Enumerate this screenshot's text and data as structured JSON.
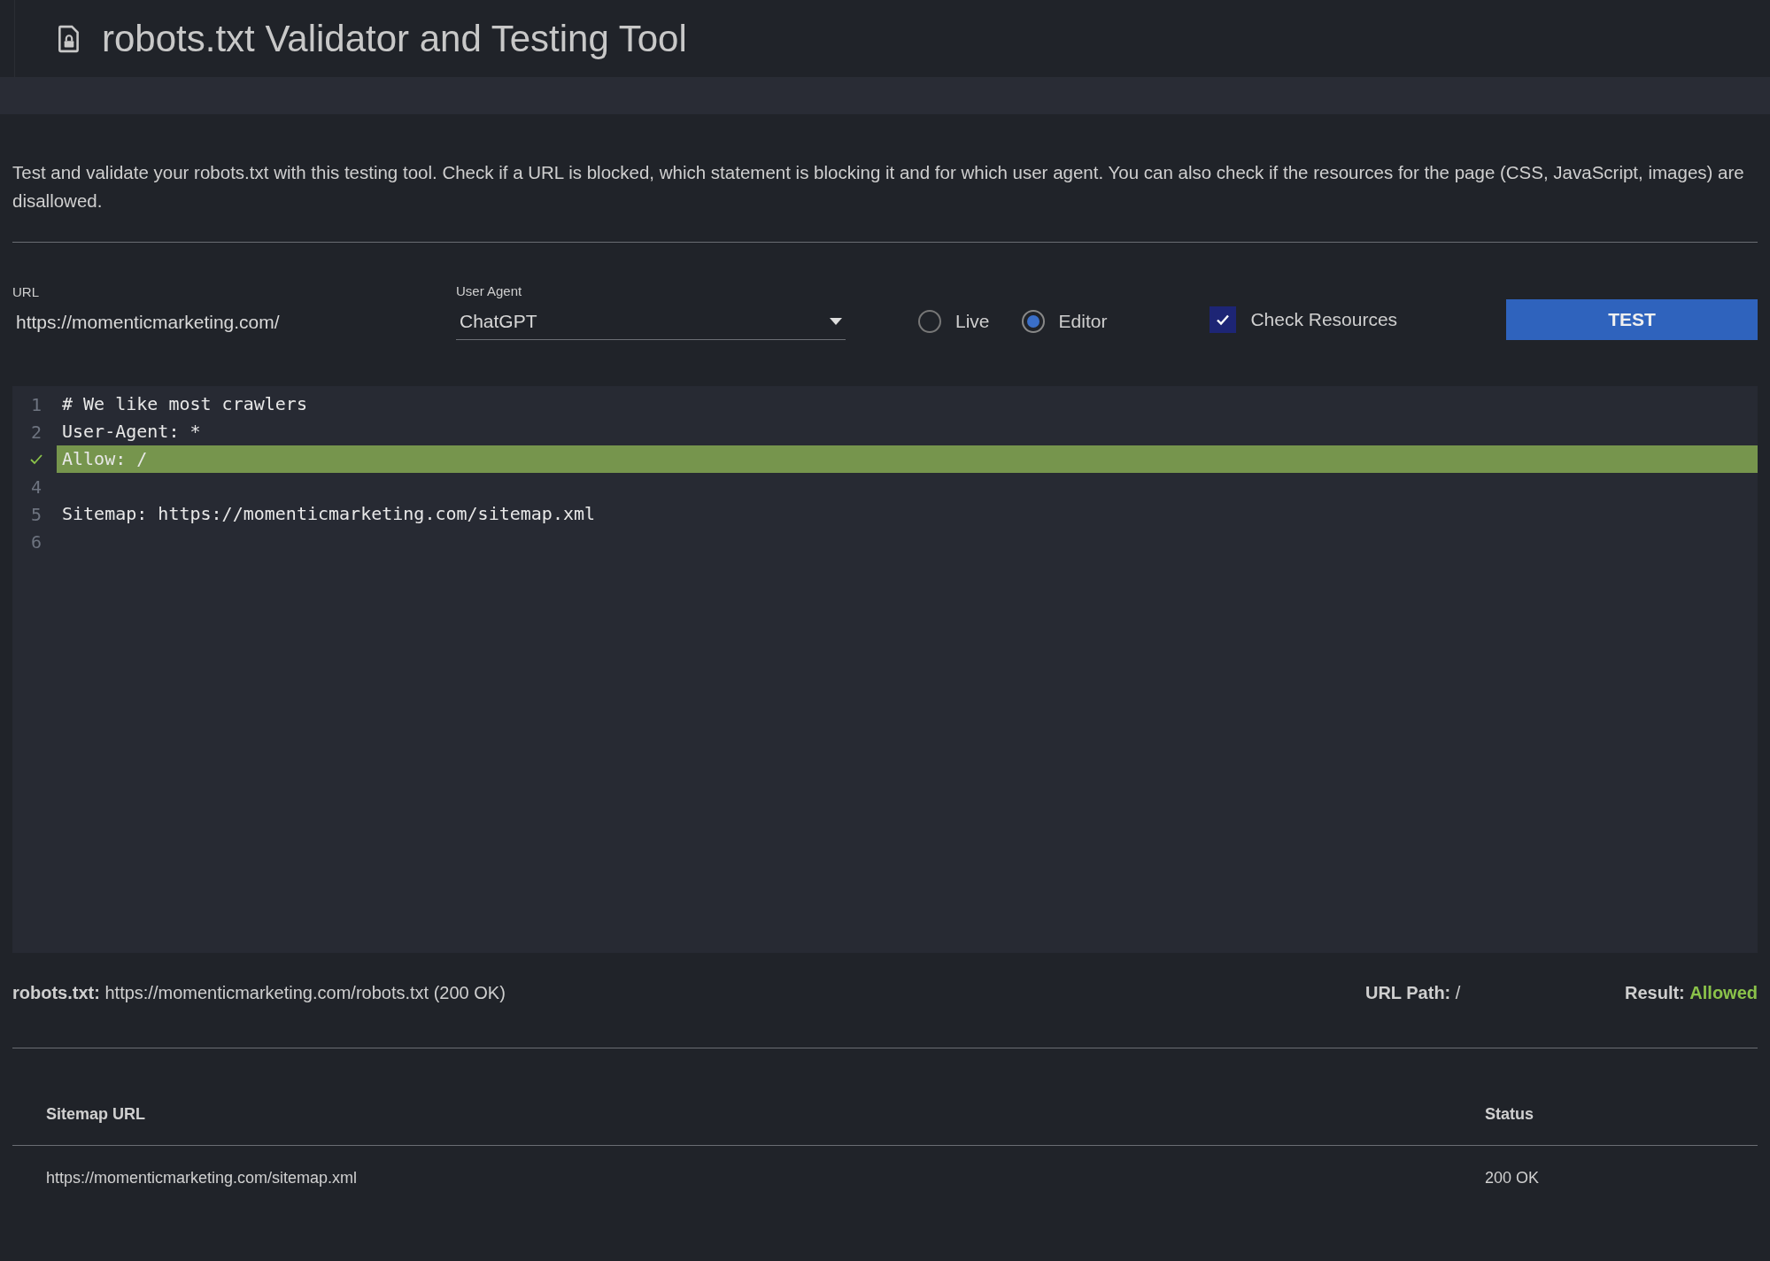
{
  "header": {
    "title": "robots.txt Validator and Testing Tool"
  },
  "description": "Test and validate your robots.txt with this testing tool. Check if a URL is blocked, which statement is blocking it and for which user agent. You can also check if the resources for the page (CSS, JavaScript, images) are disallowed.",
  "form": {
    "url": {
      "label": "URL",
      "value": "https://momenticmarketing.com/"
    },
    "user_agent": {
      "label": "User Agent",
      "value": "ChatGPT"
    },
    "modes": [
      {
        "label": "Live",
        "selected": false
      },
      {
        "label": "Editor",
        "selected": true
      }
    ],
    "check_resources": {
      "label": "Check Resources",
      "checked": true
    },
    "test_button": "TEST"
  },
  "editor": {
    "lines": [
      {
        "number": "1",
        "text": "# We like most crawlers",
        "matched": false
      },
      {
        "number": "2",
        "text": "User-Agent: *",
        "matched": false
      },
      {
        "text": "Allow: /",
        "matched": true
      },
      {
        "number": "4",
        "matched": false
      },
      {
        "number": "5",
        "text": "Sitemap: https://momenticmarketing.com/sitemap.xml",
        "matched": false
      },
      {
        "number": "6",
        "matched": false
      }
    ]
  },
  "summary": {
    "robots_label": "robots.txt:",
    "robots_value": "https://momenticmarketing.com/robots.txt (200 OK)",
    "path_label": "URL Path:",
    "path_value": "/",
    "result_label": "Result:",
    "result_value": "Allowed"
  },
  "sitemaps": {
    "columns": [
      "Sitemap URL",
      "Status"
    ],
    "rows": [
      {
        "url": "https://momenticmarketing.com/sitemap.xml",
        "status": "200 OK"
      }
    ]
  }
}
